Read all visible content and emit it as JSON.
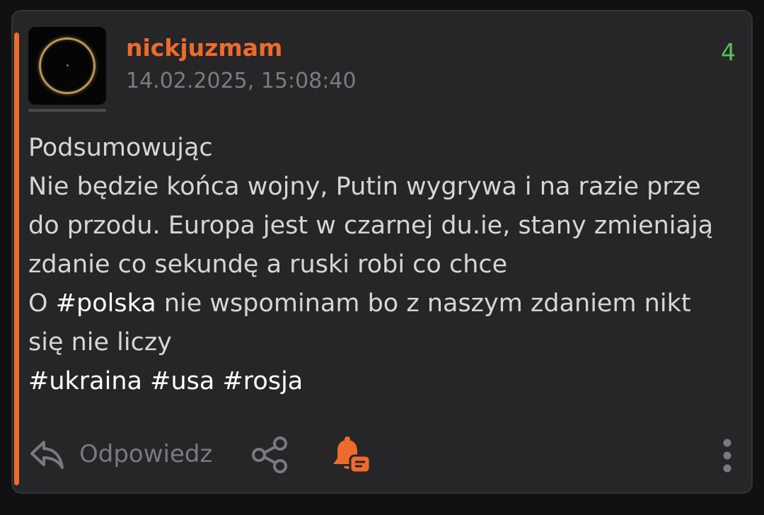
{
  "post": {
    "username": "nickjuzmam",
    "timestamp": "14.02.2025, 15:08:40",
    "score": "4",
    "body": {
      "line1": "Podsumowując",
      "line2": "Nie będzie końca wojny, Putin wygrywa i na razie prze",
      "line3": "do przodu. Europa jest w czarnej du.ie, stany zmieniają",
      "line4": "zdanie co sekundę a ruski robi co chce",
      "line5_prefix": "O ",
      "line5_tag": "#polska",
      "line5_suffix": " nie wspominam bo z naszym zdaniem nikt",
      "line6": "się nie liczy",
      "tags": [
        "#ukraina",
        "#usa",
        "#rosja"
      ]
    }
  },
  "actions": {
    "reply_label": "Odpowiedz",
    "reply_icon": "reply-arrow-icon",
    "share_icon": "share-icon",
    "notify_icon": "bell-comment-icon",
    "more_icon": "more-vertical-icon"
  },
  "colors": {
    "accent": "#ee6b2c",
    "score_positive": "#5cbf5a",
    "card_bg": "#262628",
    "page_bg": "#111113"
  }
}
